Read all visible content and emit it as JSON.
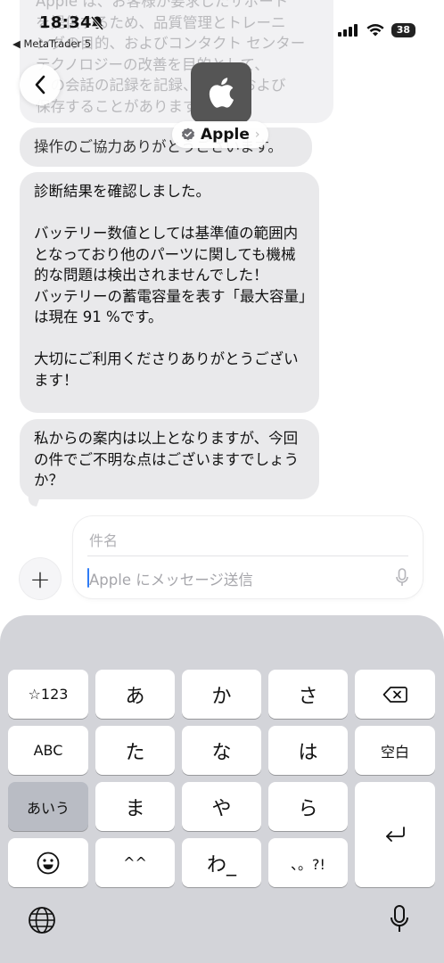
{
  "status_bar": {
    "time": "18:34",
    "back_app": "◀ MetaTrader 5",
    "battery": "38"
  },
  "header": {
    "contact_name": "Apple",
    "chevron": "›"
  },
  "messages": [
    {
      "text": "Apple は、お客様が要求したサポート\nを提供するため、品質管理とトレーニ\nングの目的、およびコンタクト センター テクノロジーの改善を目的として、\nこの会話の記録を記録、保存、および\n保存することがあります。"
    },
    {
      "text": "操作のご協力ありがとうございます。"
    },
    {
      "text": "診断結果を確認しました。\n\nバッテリー数値としては基準値の範囲内となっており他のパーツに関しても機械的な問題は検出されませんでした！\nバッテリーの蓄電容量を表す「最大容量」は現在 91 %です。\n\n大切にご利用くださりありがとうございます！"
    },
    {
      "text": "私からの案内は以上となりますが、今回の件でご不明な点はございますでしょうか？"
    }
  ],
  "compose": {
    "subject_placeholder": "件名",
    "message_placeholder": "Apple にメッセージ送信",
    "plus": "+"
  },
  "keyboard": {
    "rows": [
      [
        "☆123",
        "あ",
        "か",
        "さ",
        "⌫"
      ],
      [
        "ABC",
        "た",
        "な",
        "は",
        "空白"
      ],
      [
        "あいう",
        "ま",
        "や",
        "ら",
        "⏎"
      ],
      [
        "☺",
        "^^",
        "わ_",
        "、。?!"
      ]
    ],
    "labels": {
      "numbers": "☆123",
      "a": "あ",
      "ka": "か",
      "sa": "さ",
      "abc": "ABC",
      "ta": "た",
      "na": "な",
      "ha": "は",
      "space": "空白",
      "aiu": "あいう",
      "ma": "ま",
      "ya": "や",
      "ra": "ら",
      "emoji": "☺",
      "kaomoji": "^^",
      "wa": "わ_",
      "punct": "、。?!"
    }
  },
  "colors": {
    "bubble": "#e9e9eb",
    "keyboard_bg": "#d3d4d9",
    "caret": "#2f7cf6"
  }
}
